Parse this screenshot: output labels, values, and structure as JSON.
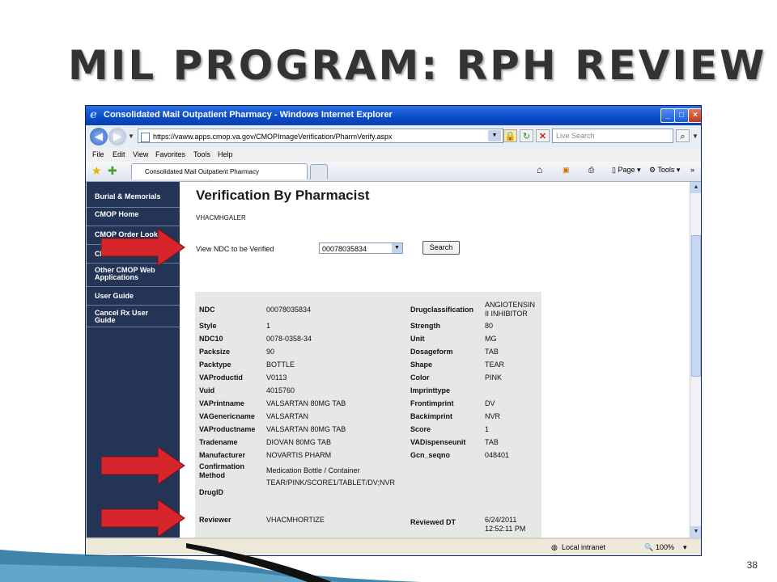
{
  "slide": {
    "title": "MIL PROGRAM: RPH REVIEW",
    "page_number": "38"
  },
  "browser": {
    "window_title": "Consolidated Mail Outpatient Pharmacy - Windows Internet Explorer",
    "url": "https://vaww.apps.cmop.va.gov/CMOPImageVerification/PharmVerify.aspx",
    "search_placeholder": "Live Search",
    "menu": [
      "File",
      "Edit",
      "View",
      "Favorites",
      "Tools",
      "Help"
    ],
    "tab_title": "Consolidated Mail Outpatient Pharmacy",
    "commands": {
      "page": "Page",
      "tools": "Tools"
    },
    "status": {
      "zone": "Local intranet",
      "zoom": "100%"
    }
  },
  "sidebar": {
    "items": [
      {
        "label": "Burial & Memorials"
      },
      {
        "label": "CMOP Home"
      },
      {
        "label": "CMOP Order Looku"
      },
      {
        "label": "CM"
      },
      {
        "label": "Other CMOP Web\nApplications"
      },
      {
        "label": "User Guide"
      },
      {
        "label": "Cancel Rx User\nGuide"
      }
    ]
  },
  "page": {
    "title": "Verification By Pharmacist",
    "user": "VHACMHGALER",
    "ndc_label": "View NDC to be Verified",
    "ndc_selected": "00078035834",
    "search_button": "Search"
  },
  "details": {
    "left": [
      {
        "label": "NDC",
        "value": "00078035834"
      },
      {
        "label": "Style",
        "value": "1"
      },
      {
        "label": "NDC10",
        "value": "0078-0358-34"
      },
      {
        "label": "Packsize",
        "value": "90"
      },
      {
        "label": "Packtype",
        "value": "BOTTLE"
      },
      {
        "label": "VAProductid",
        "value": "V0113"
      },
      {
        "label": "Vuid",
        "value": "4015760"
      },
      {
        "label": "VAPrintname",
        "value": "VALSARTAN 80MG TAB"
      },
      {
        "label": "VAGenericname",
        "value": "VALSARTAN"
      },
      {
        "label": "VAProductname",
        "value": "VALSARTAN 80MG TAB"
      },
      {
        "label": "Tradename",
        "value": "DIOVAN 80MG TAB"
      },
      {
        "label": "Manufacturer",
        "value": "NOVARTIS PHARM"
      },
      {
        "label": "Confirmation\nMethod",
        "value": "Medication Bottle / Container"
      },
      {
        "label": "DrugID",
        "value": "TEAR/PINK/SCORE1/TABLET/DV;NVR"
      },
      {
        "label": "Reviewer",
        "value": "VHACMHORTIZE"
      }
    ],
    "right": [
      {
        "label": "Drugclassification",
        "value": "ANGIOTENSIN\nII INHIBITOR"
      },
      {
        "label": "Strength",
        "value": "80"
      },
      {
        "label": "Unit",
        "value": "MG"
      },
      {
        "label": "Dosageform",
        "value": "TAB"
      },
      {
        "label": "Shape",
        "value": "TEAR"
      },
      {
        "label": "Color",
        "value": "PINK"
      },
      {
        "label": "Imprinttype",
        "value": ""
      },
      {
        "label": "Frontimprint",
        "value": "DV"
      },
      {
        "label": "Backimprint",
        "value": "NVR"
      },
      {
        "label": "Score",
        "value": "1"
      },
      {
        "label": "VADispenseunit",
        "value": "TAB"
      },
      {
        "label": "Gcn_seqno",
        "value": "048401"
      },
      {
        "label": "Reviewed DT",
        "value": "6/24/2011\n12:52:11 PM"
      }
    ]
  },
  "colors": {
    "nav_bg": "#243457",
    "panel_bg": "#e6e8e6",
    "arrow_red": "#d7262b",
    "titlebar_blue": "#0a4bc8"
  },
  "icons": [
    "back-icon",
    "forward-icon",
    "ie-logo-icon",
    "lock-icon",
    "refresh-icon",
    "stop-icon",
    "search-icon",
    "favorites-star-icon",
    "add-favorites-icon",
    "home-icon",
    "feeds-icon",
    "print-icon",
    "page-icon",
    "tools-gear-icon",
    "globe-icon",
    "zoom-icon"
  ]
}
